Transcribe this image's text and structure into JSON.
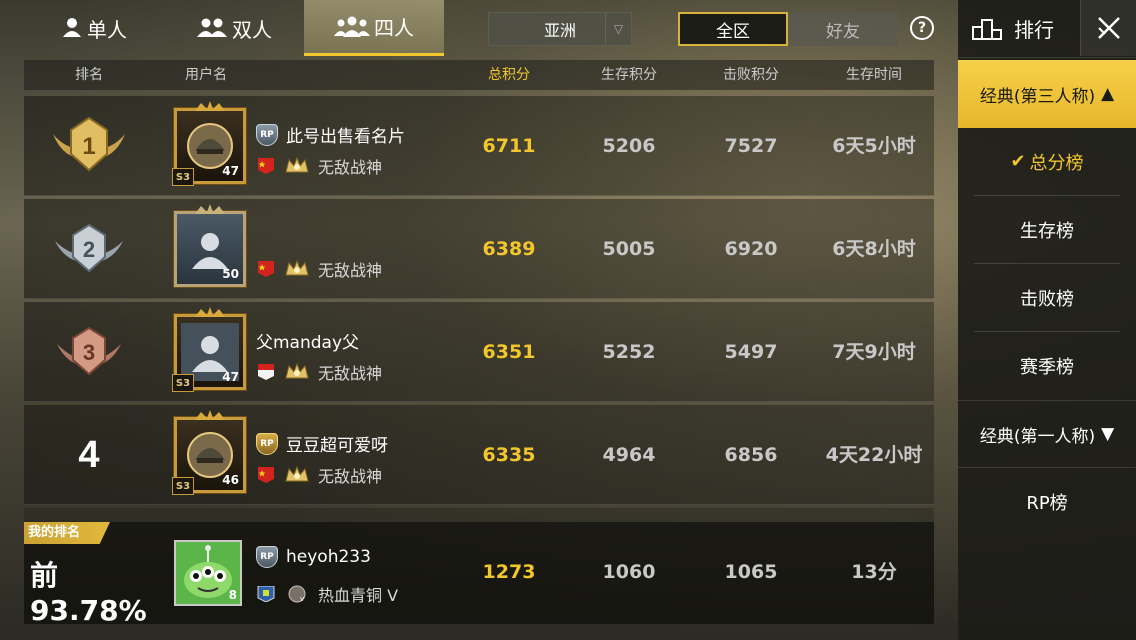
{
  "top_tabs": [
    {
      "label": "单人",
      "icon": "single-person-icon",
      "active": false
    },
    {
      "label": "双人",
      "icon": "duo-people-icon",
      "active": false
    },
    {
      "label": "四人",
      "icon": "squad-people-icon",
      "active": true
    }
  ],
  "region": {
    "value": "亚洲"
  },
  "scope": {
    "all_label": "全区",
    "friends_label": "好友",
    "active": "all"
  },
  "table": {
    "headers": {
      "rank": "排名",
      "username": "用户名",
      "total": "总积分",
      "survival": "生存积分",
      "kills": "击败积分",
      "time": "生存时间"
    },
    "rows": [
      {
        "rank": "1",
        "rank_badge": "gold-rank-1-icon",
        "name": "此号出售看名片",
        "rp_badge": "silver",
        "level": "47",
        "season": "S3",
        "flag": "china",
        "tier": "无敌战神",
        "total": "6711",
        "survival": "5206",
        "kills": "7527",
        "time": "6天5小时"
      },
      {
        "rank": "2",
        "rank_badge": "silver-rank-2-icon",
        "name": "",
        "rp_badge": "none",
        "level": "50",
        "season": "",
        "flag": "china",
        "tier": "无敌战神",
        "total": "6389",
        "survival": "5005",
        "kills": "6920",
        "time": "6天8小时"
      },
      {
        "rank": "3",
        "rank_badge": "bronze-rank-3-icon",
        "name": "父manday父",
        "rp_badge": "none",
        "level": "47",
        "season": "S3",
        "flag": "indonesia",
        "tier": "无敌战神",
        "total": "6351",
        "survival": "5252",
        "kills": "5497",
        "time": "7天9小时"
      },
      {
        "rank": "4",
        "rank_badge": "",
        "name": "豆豆超可爱呀",
        "rp_badge": "gold",
        "level": "46",
        "season": "S3",
        "flag": "china",
        "tier": "无敌战神",
        "total": "6335",
        "survival": "4964",
        "kills": "6856",
        "time": "4天22小时"
      }
    ]
  },
  "my_rank": {
    "tag": "我的排名",
    "percent": "前93.78%",
    "name": "heyoh233",
    "level": "8",
    "tier": "热血青铜 V",
    "total": "1273",
    "survival": "1060",
    "kills": "1065",
    "time": "13分"
  },
  "sidebar": {
    "title": "排行",
    "categories": [
      {
        "label": "经典(第三人称)",
        "arrow": "▲",
        "active": true
      },
      {
        "label": "经典(第一人称)",
        "arrow": "▼",
        "active": false
      }
    ],
    "items": [
      {
        "label": "总分榜",
        "check": "✔",
        "active": true
      },
      {
        "label": "生存榜",
        "active": false
      },
      {
        "label": "击败榜",
        "active": false
      },
      {
        "label": "赛季榜",
        "active": false
      }
    ],
    "rp_label": "RP榜"
  },
  "colors": {
    "accent": "#f3c72b",
    "score_total": "#f3c72b",
    "sidebar_active": "#f6d04a"
  }
}
